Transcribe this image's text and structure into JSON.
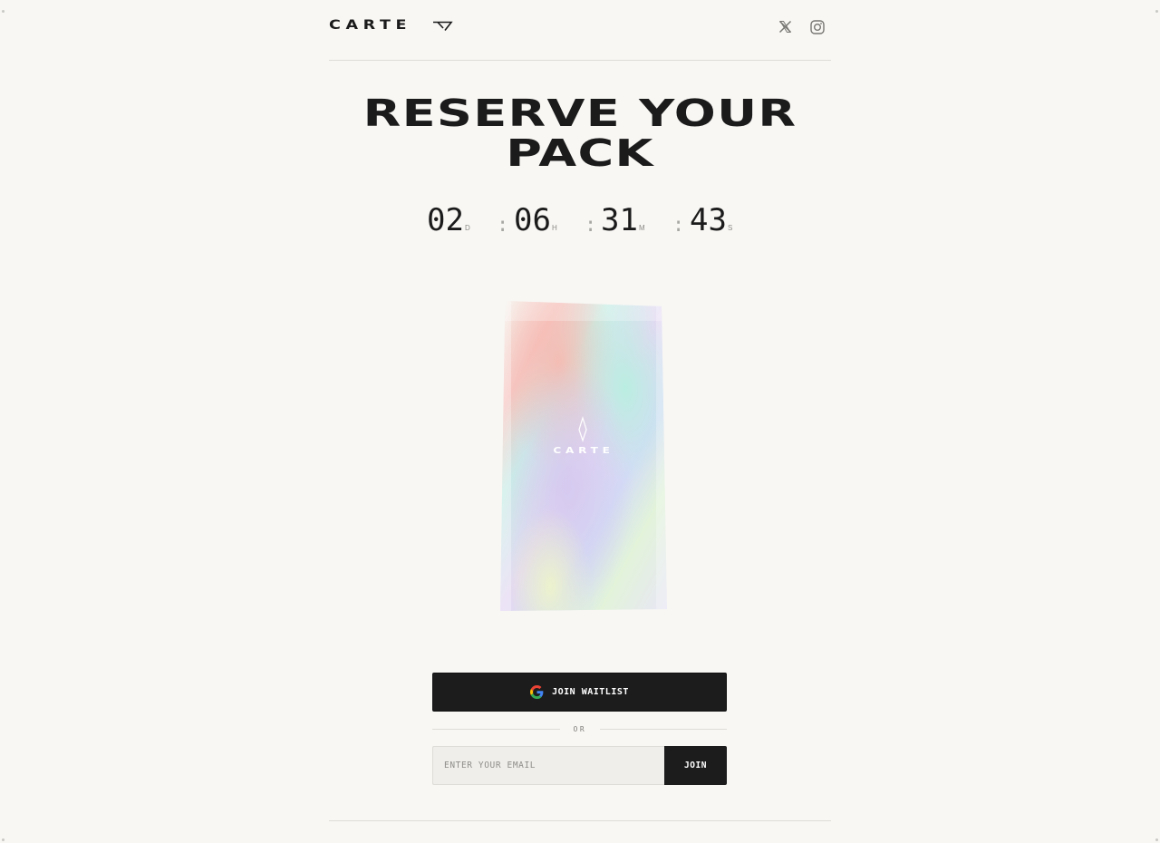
{
  "header": {
    "logo_text": "CARTE",
    "social": [
      "x-icon",
      "instagram-icon"
    ]
  },
  "title": {
    "line1": "RESERVE YOUR",
    "line2": "PACK"
  },
  "countdown": {
    "days": "02",
    "days_label": "D",
    "hours": "06",
    "hours_label": "H",
    "minutes": "31",
    "minutes_label": "M",
    "seconds": "43",
    "seconds_label": "S",
    "separator": ":"
  },
  "pack": {
    "brand": "CARTE"
  },
  "waitlist": {
    "button_label": "JOIN WAITLIST",
    "icon": "google-icon",
    "or_label": "OR",
    "email_placeholder": "ENTER YOUR EMAIL",
    "email_value": "",
    "join_label": "JOIN"
  },
  "colors": {
    "background": "#f8f7f4",
    "primary": "#1c1c1c",
    "rule": "#dedcd7"
  }
}
